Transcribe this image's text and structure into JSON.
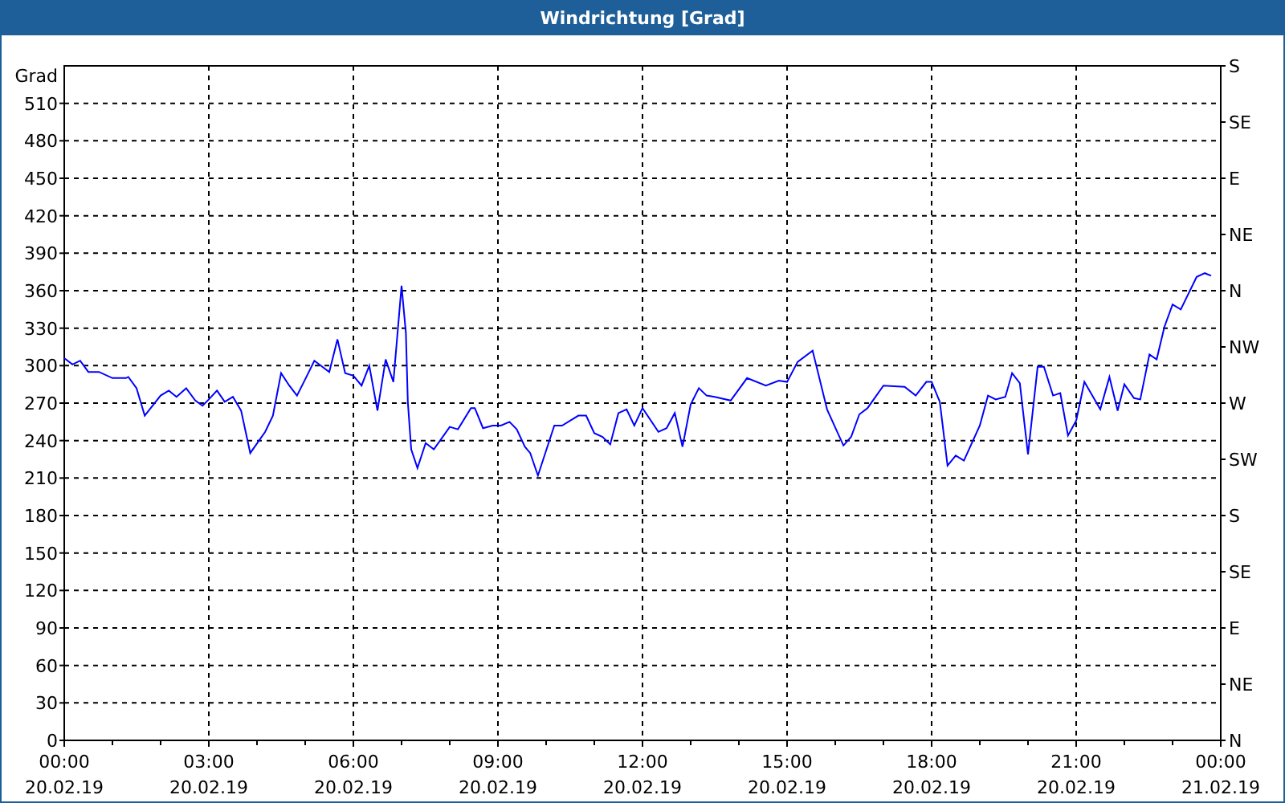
{
  "window": {
    "title": "Windrichtung [Grad]"
  },
  "chart": {
    "chart_data": {
      "type": "line",
      "grid": true,
      "ylabel": "Grad",
      "ylim": [
        0,
        540
      ],
      "xlim": [
        0,
        24
      ],
      "yticks": [
        0,
        30,
        60,
        90,
        120,
        150,
        180,
        210,
        240,
        270,
        300,
        330,
        360,
        390,
        420,
        450,
        480,
        510
      ],
      "xticks": [
        {
          "value": 0,
          "label": "00:00"
        },
        {
          "value": 3,
          "label": "03:00"
        },
        {
          "value": 6,
          "label": "06:00"
        },
        {
          "value": 9,
          "label": "09:00"
        },
        {
          "value": 12,
          "label": "12:00"
        },
        {
          "value": 15,
          "label": "15:00"
        },
        {
          "value": 18,
          "label": "18:00"
        },
        {
          "value": 21,
          "label": "21:00"
        },
        {
          "value": 24,
          "label": "00:00"
        }
      ],
      "x": [
        0,
        0.17,
        0.33,
        0.5,
        0.72,
        1.0,
        1.28,
        1.33,
        1.5,
        1.67,
        2.0,
        2.17,
        2.33,
        2.53,
        2.72,
        2.87,
        3.0,
        3.17,
        3.33,
        3.5,
        3.67,
        3.86,
        4.17,
        4.33,
        4.5,
        4.67,
        4.83,
        5.0,
        5.19,
        5.5,
        5.67,
        5.83,
        6.0,
        6.17,
        6.33,
        6.5,
        6.67,
        6.83,
        7.0,
        7.09,
        7.13,
        7.2,
        7.33,
        7.5,
        7.67,
        8.0,
        8.17,
        8.44,
        8.52,
        8.69,
        8.89,
        9.06,
        9.24,
        9.39,
        9.56,
        9.67,
        9.83,
        10.17,
        10.33,
        10.67,
        10.83,
        11.0,
        11.17,
        11.33,
        11.5,
        11.67,
        11.83,
        12.0,
        12.33,
        12.5,
        12.67,
        12.83,
        13.0,
        13.17,
        13.33,
        13.5,
        13.83,
        14.17,
        14.56,
        14.83,
        15.0,
        15.22,
        15.53,
        15.83,
        16.17,
        16.33,
        16.5,
        16.67,
        17.0,
        17.44,
        17.67,
        17.89,
        18.0,
        18.17,
        18.33,
        18.5,
        18.67,
        19.0,
        19.17,
        19.33,
        19.53,
        19.67,
        19.83,
        20.0,
        20.2,
        20.33,
        20.52,
        20.67,
        20.83,
        21.0,
        21.17,
        21.5,
        21.69,
        21.86,
        22.0,
        22.2,
        22.33,
        22.52,
        22.67,
        22.83,
        23.0,
        23.17,
        23.5,
        23.67,
        23.8
      ],
      "series": [
        {
          "color": "#0000ff",
          "values": [
            306,
            301,
            304,
            295,
            295,
            290,
            290,
            291,
            282,
            260,
            276,
            280,
            275,
            282,
            272,
            268,
            273,
            280,
            271,
            275,
            264,
            230,
            247,
            260,
            294,
            284,
            276,
            289,
            304,
            295,
            321,
            294,
            292,
            284,
            300,
            264,
            305,
            287,
            364,
            326,
            271,
            233,
            218,
            238,
            233,
            251,
            249,
            266,
            266,
            250,
            252,
            252,
            255,
            249,
            235,
            230,
            212,
            252,
            252,
            260,
            260,
            246,
            243,
            237,
            262,
            265,
            252,
            266,
            247,
            250,
            262,
            235,
            269,
            282,
            276,
            275,
            272,
            290,
            284,
            288,
            287,
            303,
            312,
            265,
            236,
            243,
            261,
            266,
            284,
            283,
            276,
            287,
            287,
            271,
            220,
            228,
            224,
            252,
            276,
            273,
            275,
            294,
            286,
            229,
            299,
            299,
            276,
            278,
            244,
            256,
            287,
            265,
            291,
            264,
            285,
            274,
            273,
            309,
            305,
            331,
            349,
            345,
            371,
            374,
            372
          ]
        }
      ]
    },
    "x_dates": [
      "20.02.19",
      "20.02.19",
      "20.02.19",
      "20.02.19",
      "20.02.19",
      "20.02.19",
      "20.02.19",
      "20.02.19",
      "21.02.19"
    ],
    "right_axis": [
      "S",
      "SE",
      "E",
      "NE",
      "N",
      "NW",
      "W",
      "SW",
      "S",
      "SE",
      "E",
      "NE",
      "N"
    ]
  }
}
